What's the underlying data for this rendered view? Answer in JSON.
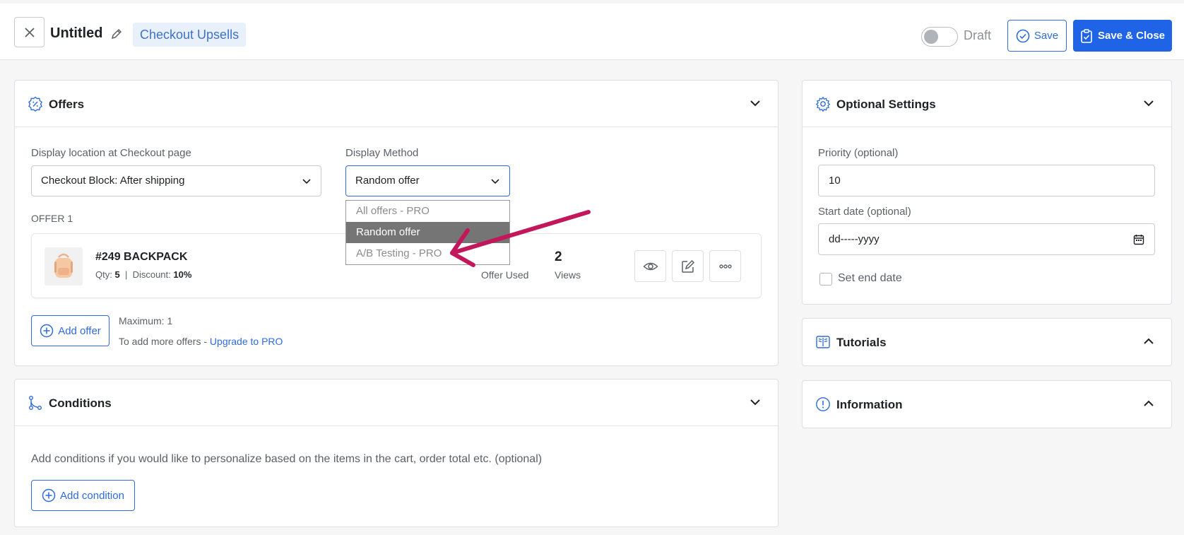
{
  "header": {
    "title": "Untitled",
    "tag": "Checkout Upsells",
    "draft_label": "Draft",
    "save_label": "Save",
    "save_close_label": "Save & Close"
  },
  "offers": {
    "title": "Offers",
    "display_location_label": "Display location at Checkout page",
    "display_location_value": "Checkout Block: After shipping",
    "display_method_label": "Display Method",
    "display_method_value": "Random offer",
    "display_method_options": [
      "All offers - PRO",
      "Random offer",
      "A/B Testing - PRO"
    ],
    "offer_heading": "OFFER 1",
    "offer": {
      "name": "#249 BACKPACK",
      "qty_label": "Qty:",
      "qty_value": "5",
      "separator": "|",
      "discount_label": "Discount:",
      "discount_value": "10%",
      "offer_used_label": "Offer Used",
      "views_value": "2",
      "views_label": "Views"
    },
    "add_offer_label": "Add offer",
    "maximum_text": "Maximum: 1",
    "more_offers_text": "To add more offers - ",
    "upgrade_link": "Upgrade to PRO"
  },
  "conditions": {
    "title": "Conditions",
    "description": "Add conditions if you would like to personalize based on the items in the cart, order total etc. (optional)",
    "add_condition_label": "Add condition"
  },
  "optional_settings": {
    "title": "Optional Settings",
    "priority_label": "Priority (optional)",
    "priority_value": "10",
    "start_date_label": "Start date (optional)",
    "start_date_value": "dd-----yyyy",
    "set_end_date_label": "Set end date"
  },
  "tutorials": {
    "title": "Tutorials"
  },
  "information": {
    "title": "Information"
  },
  "colors": {
    "accent": "#1f63e6",
    "annotation_arrow": "#c2185b"
  }
}
